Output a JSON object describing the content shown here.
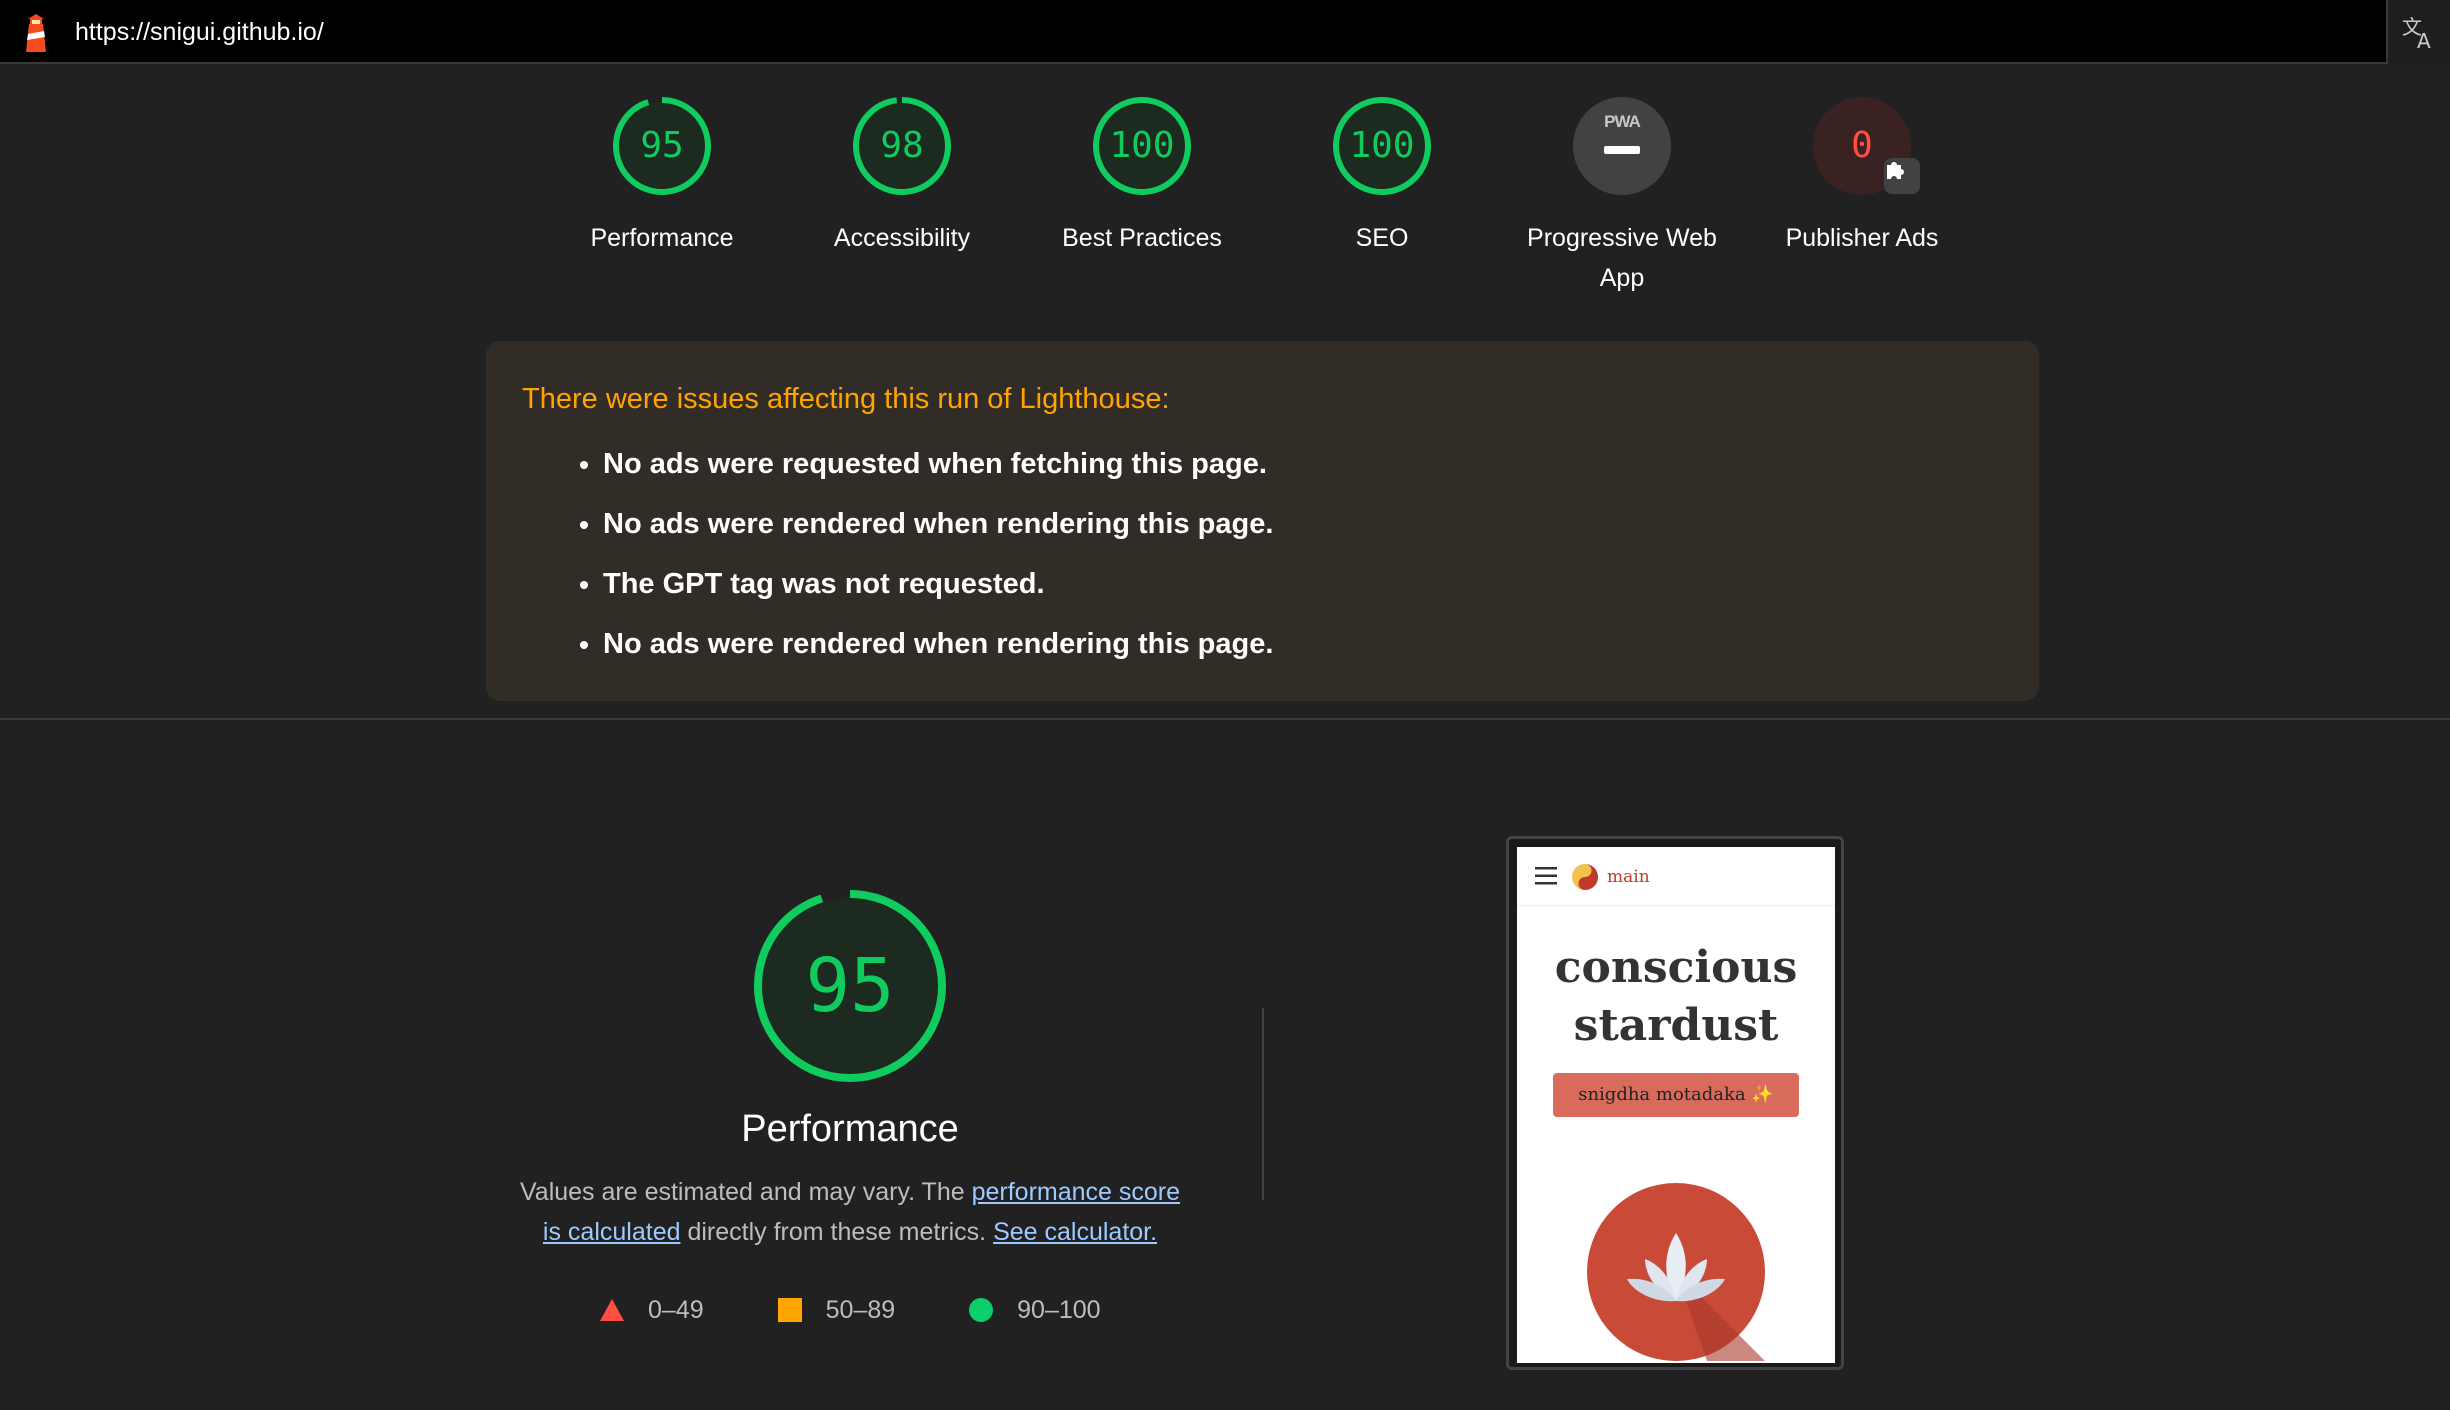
{
  "topbar": {
    "url": "https://snigui.github.io/"
  },
  "gauges": [
    {
      "label": "Performance",
      "score": "95",
      "value": 95,
      "color": "#10cc5e"
    },
    {
      "label": "Accessibility",
      "score": "98",
      "value": 98,
      "color": "#10cc5e"
    },
    {
      "label": "Best Practices",
      "score": "100",
      "value": 100,
      "color": "#10cc5e"
    },
    {
      "label": "SEO",
      "score": "100",
      "value": 100,
      "color": "#10cc5e"
    },
    {
      "label": "Progressive Web App",
      "badge": "PWA"
    },
    {
      "label": "Publisher Ads",
      "score": "0",
      "value": 0,
      "color": "#ff4e42",
      "icon": "puzzle-icon"
    }
  ],
  "warnings": {
    "title": "There were issues affecting this run of Lighthouse:",
    "items": [
      "No ads were requested when fetching this page.",
      "No ads were rendered when rendering this page.",
      "The GPT tag was not requested.",
      "No ads were rendered when rendering this page."
    ]
  },
  "performance": {
    "score": "95",
    "value": 95,
    "title": "Performance",
    "desc_prefix": "Values are estimated and may vary. The ",
    "desc_link1": "performance score is calculated",
    "desc_middle": " directly from these metrics. ",
    "desc_link2": "See calculator.",
    "legend": [
      {
        "range": "0–49",
        "shape": "triangle",
        "color": "#ff4e42"
      },
      {
        "range": "50–89",
        "shape": "square",
        "color": "#ffa400"
      },
      {
        "range": "90–100",
        "shape": "circle",
        "color": "#0cce6b"
      }
    ]
  },
  "thumbnail": {
    "nav_label": "main",
    "site_title_line1": "conscious",
    "site_title_line2": "stardust",
    "button_label": "snigdha motadaka ✨"
  },
  "colors": {
    "pass": "#10cc5e",
    "fail": "#ff4e42",
    "warn": "#ffa400",
    "background": "#212121"
  }
}
